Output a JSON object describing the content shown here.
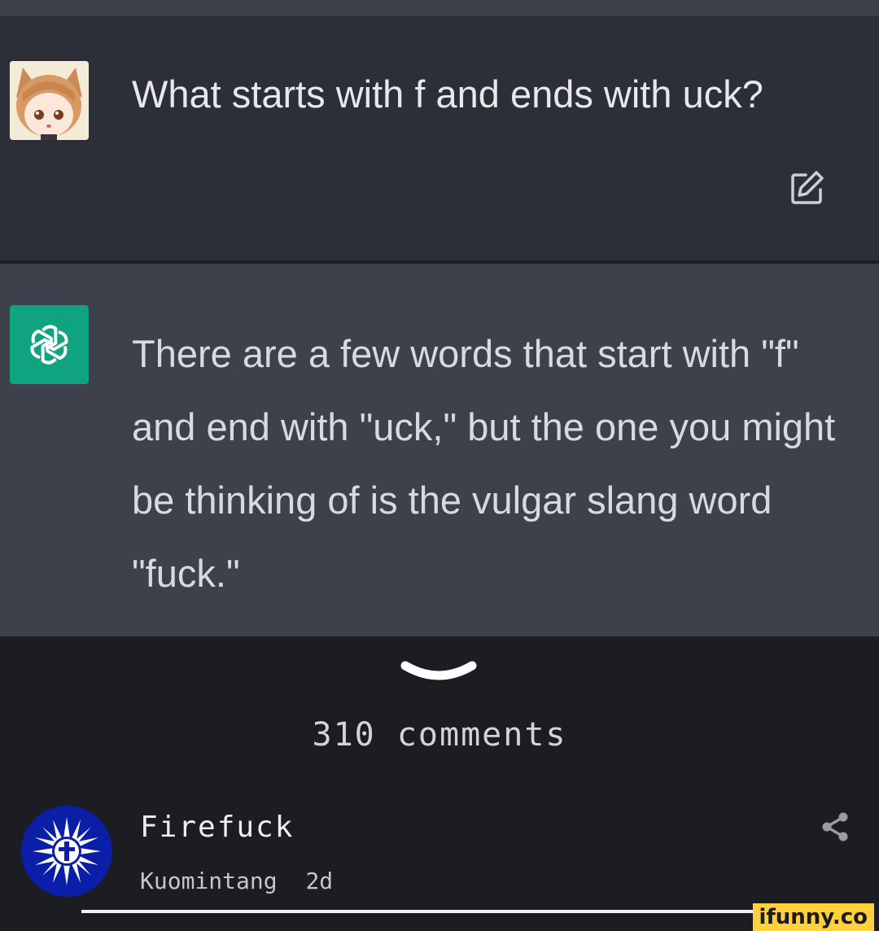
{
  "user_message": {
    "text": "What starts with f and ends with uck?",
    "avatar_icon": "anime-fox-girl-avatar",
    "edit_icon": "edit-icon"
  },
  "assistant_message": {
    "text": "There are a few words that start with \"f\" and end with \"uck,\" but the one you might be thinking of is the vulgar slang word \"fuck.\"",
    "avatar_icon": "openai-logo-icon",
    "avatar_color": "#10a37f"
  },
  "comments_section": {
    "expand_icon": "chevron-down-icon",
    "count_label": "310 comments"
  },
  "comment": {
    "username": "Firefuck",
    "flair": "Kuomintang",
    "age": "2d",
    "share_icon": "share-icon",
    "avatar_icon": "blue-sky-white-sun-emblem-icon"
  },
  "watermark": {
    "text": "ifunny.co",
    "color": "#ffd13b"
  }
}
